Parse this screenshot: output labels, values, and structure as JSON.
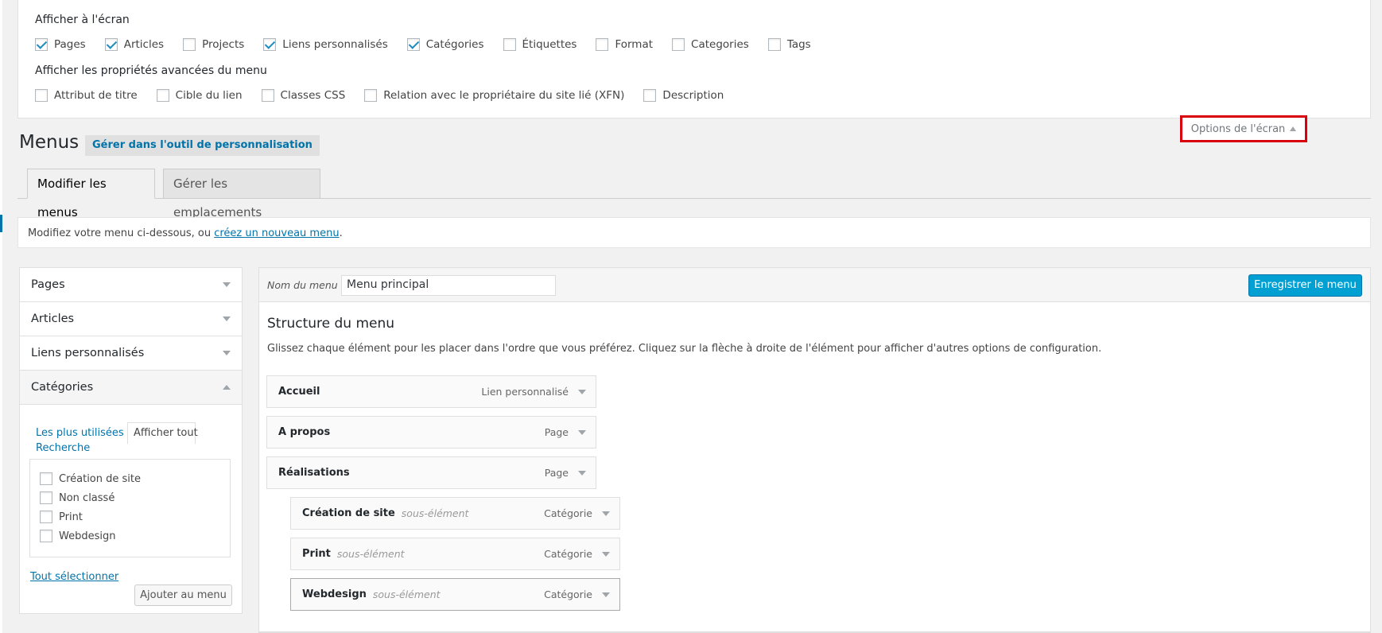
{
  "screen_options": {
    "title": "Afficher à l'écran",
    "items": [
      {
        "label": "Pages",
        "checked": true
      },
      {
        "label": "Articles",
        "checked": true
      },
      {
        "label": "Projects",
        "checked": false
      },
      {
        "label": "Liens personnalisés",
        "checked": true
      },
      {
        "label": "Catégories",
        "checked": true
      },
      {
        "label": "Étiquettes",
        "checked": false
      },
      {
        "label": "Format",
        "checked": false
      },
      {
        "label": "Categories",
        "checked": false
      },
      {
        "label": "Tags",
        "checked": false
      }
    ],
    "advanced_title": "Afficher les propriétés avancées du menu",
    "advanced_items": [
      {
        "label": "Attribut de titre",
        "checked": false
      },
      {
        "label": "Cible du lien",
        "checked": false
      },
      {
        "label": "Classes CSS",
        "checked": false
      },
      {
        "label": "Relation avec le propriétaire du site lié (XFN)",
        "checked": false
      },
      {
        "label": "Description",
        "checked": false
      }
    ],
    "toggle_label": "Options de l'écran"
  },
  "header": {
    "title": "Menus",
    "customize_label": "Gérer dans l'outil de personnalisation"
  },
  "tabs": [
    {
      "label": "Modifier les menus",
      "active": true
    },
    {
      "label": "Gérer les emplacements",
      "active": false
    }
  ],
  "notice": {
    "text": "Modifiez votre menu ci-dessous, ou ",
    "link": "créez un nouveau menu",
    "end": "."
  },
  "accordion": {
    "sections": [
      "Pages",
      "Articles",
      "Liens personnalisés",
      "Catégories"
    ],
    "subtabs": {
      "most_used": "Les plus utilisées",
      "show_all": "Afficher tout",
      "search": "Recherche"
    },
    "categories": [
      "Création de site",
      "Non classé",
      "Print",
      "Webdesign"
    ],
    "select_all": "Tout sélectionner",
    "add_button": "Ajouter au menu"
  },
  "menu_edit": {
    "name_label": "Nom du menu",
    "name_value": "Menu principal",
    "save_button": "Enregistrer le menu",
    "structure_title": "Structure du menu",
    "structure_desc": "Glissez chaque élément pour les placer dans l'ordre que vous préférez. Cliquez sur la flèche à droite de l'élément pour afficher d'autres options de configuration.",
    "items": [
      {
        "title": "Accueil",
        "sub": "",
        "type": "Lien personnalisé"
      },
      {
        "title": "A propos",
        "sub": "",
        "type": "Page"
      },
      {
        "title": "Réalisations",
        "sub": "",
        "type": "Page"
      },
      {
        "title": "Création de site",
        "sub": "sous-élément",
        "type": "Catégorie"
      },
      {
        "title": "Print",
        "sub": "sous-élément",
        "type": "Catégorie"
      },
      {
        "title": "Webdesign",
        "sub": "sous-élément",
        "type": "Catégorie"
      }
    ]
  },
  "colors": {
    "accent": "#0073aa",
    "primary_button": "#00a0d2",
    "highlight_border": "#d9000d"
  }
}
